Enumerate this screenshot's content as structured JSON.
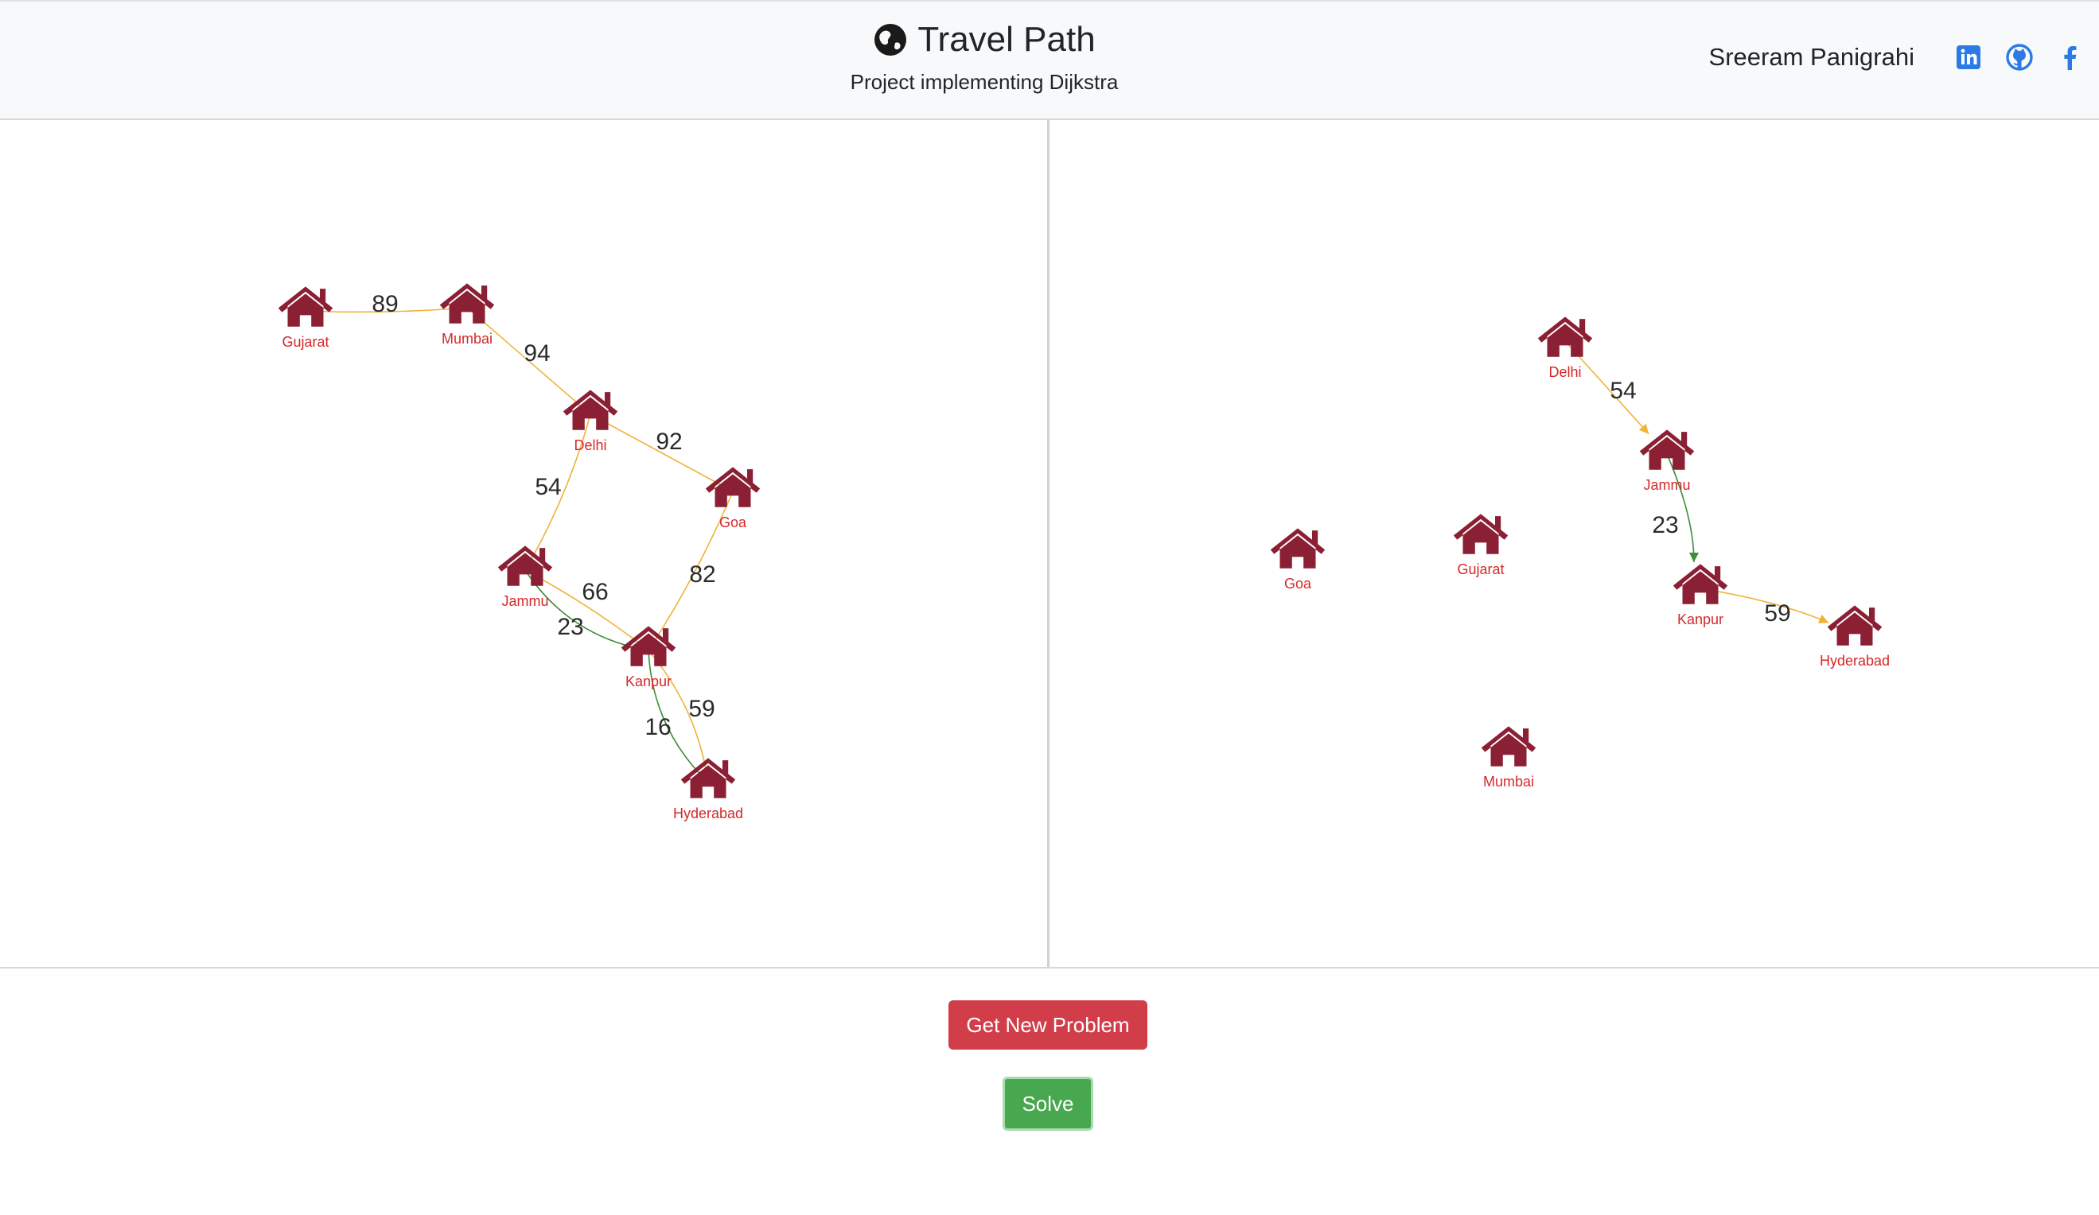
{
  "header": {
    "title": "Travel Path",
    "subtitle": "Project implementing Dijkstra",
    "author": "Sreeram Panigrahi",
    "social": [
      "linkedin-icon",
      "github-icon",
      "facebook-icon"
    ]
  },
  "colors": {
    "node": "#8b1f33",
    "node_label": "#d62828",
    "edge": "#f0b33a",
    "path_edge": "#3f8c3a",
    "new_problem_button": "#d13e4a",
    "solve_button": "#48a84f"
  },
  "problem_graph": {
    "nodes": [
      "Gujarat",
      "Mumbai",
      "Delhi",
      "Goa",
      "Jammu",
      "Kanpur",
      "Hyderabad"
    ],
    "edges": [
      {
        "from": "Gujarat",
        "to": "Mumbai",
        "weight": "89"
      },
      {
        "from": "Mumbai",
        "to": "Delhi",
        "weight": "94"
      },
      {
        "from": "Delhi",
        "to": "Goa",
        "weight": "92"
      },
      {
        "from": "Delhi",
        "to": "Jammu",
        "weight": "54"
      },
      {
        "from": "Jammu",
        "to": "Kanpur",
        "weight": "66"
      },
      {
        "from": "Goa",
        "to": "Kanpur",
        "weight": "82"
      },
      {
        "from": "Jammu",
        "to": "Kanpur",
        "weight": "23"
      },
      {
        "from": "Kanpur",
        "to": "Hyderabad",
        "weight": "59"
      },
      {
        "from": "Kanpur",
        "to": "Hyderabad",
        "weight": "16"
      }
    ]
  },
  "solution_graph": {
    "nodes": [
      "Delhi",
      "Jammu",
      "Goa",
      "Gujarat",
      "Kanpur",
      "Hyderabad",
      "Mumbai"
    ],
    "edges": [
      {
        "from": "Delhi",
        "to": "Jammu",
        "weight": "54"
      },
      {
        "from": "Jammu",
        "to": "Kanpur",
        "weight": "23"
      },
      {
        "from": "Kanpur",
        "to": "Hyderabad",
        "weight": "59"
      }
    ]
  },
  "buttons": {
    "new_problem": "Get New Problem",
    "solve": "Solve"
  }
}
